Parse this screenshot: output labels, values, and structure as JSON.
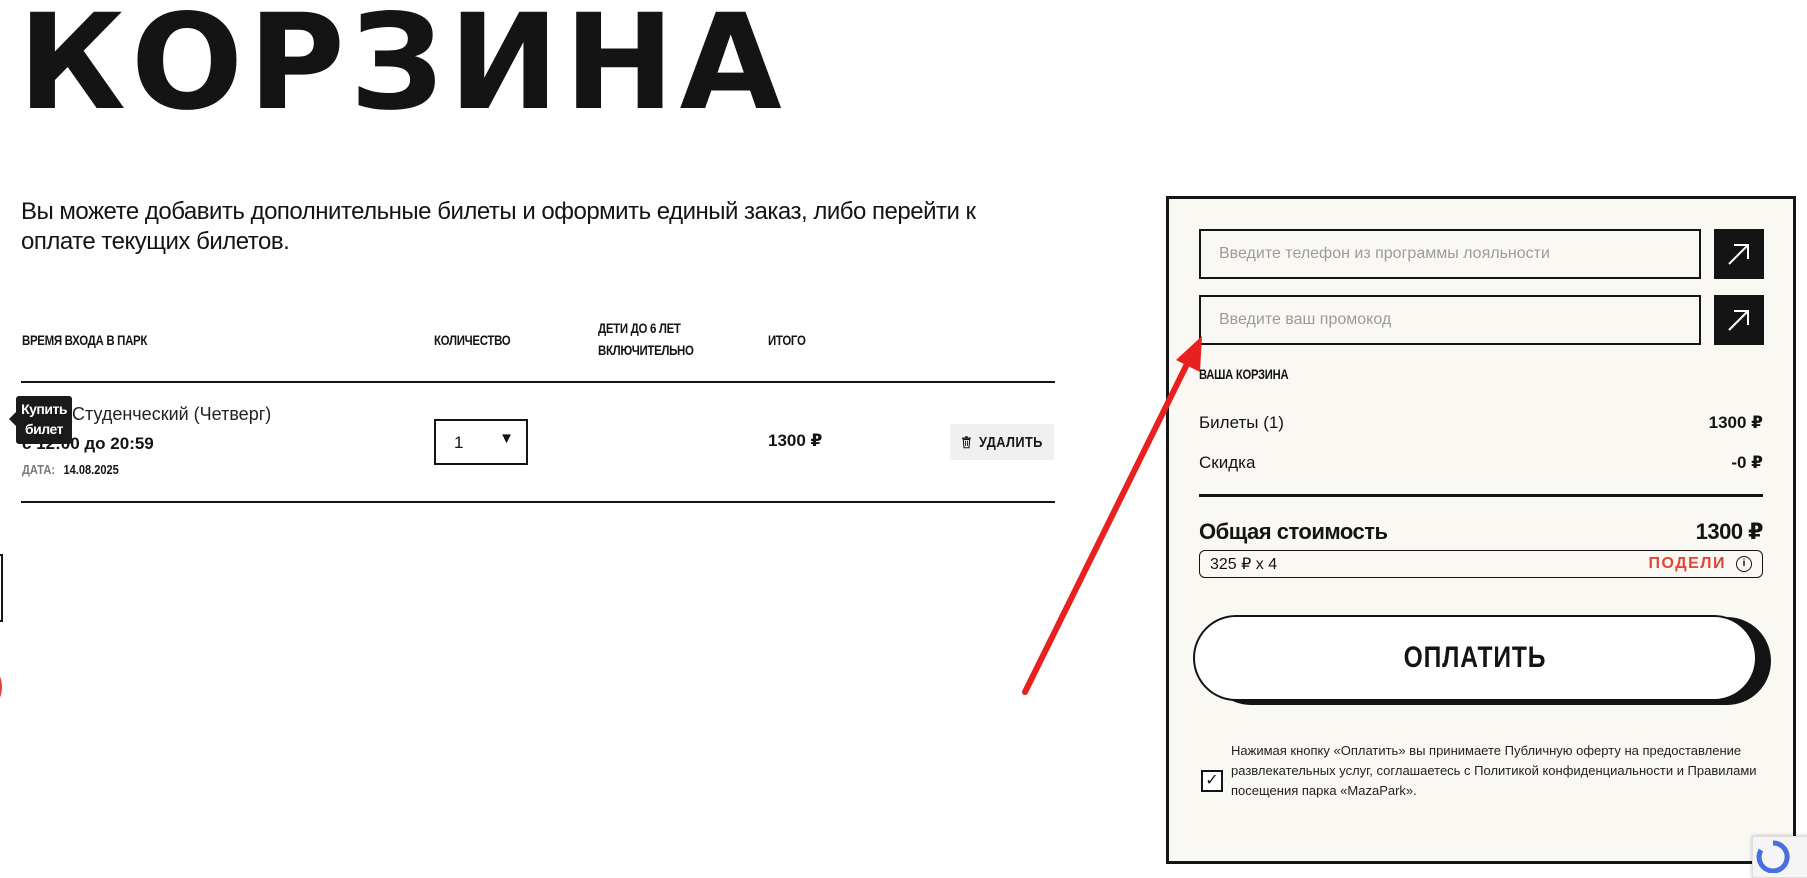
{
  "page": {
    "title": "КОРЗИНА",
    "intro": "Вы можете добавить дополнительные билеты и оформить единый заказ, либо перейти к оплате текущих билетов."
  },
  "table": {
    "headers": {
      "time": "ВРЕМЯ ВХОДА В ПАРК",
      "quantity": "КОЛИЧЕСТВО",
      "children_l1": "ДЕТИ ДО 6 ЛЕТ",
      "children_l2": "ВКЛЮЧИТЕЛЬНО",
      "total": "ИТОГО"
    },
    "row": {
      "name": "Студенческий (Четверг)",
      "time": "с 12:00 до 20:59",
      "date_label": "ДАТА:",
      "date": "14.08.2025",
      "quantity": "1",
      "total": "1300 ₽",
      "delete_label": "УДАЛИТЬ"
    },
    "tooltip_l1": "Купить",
    "tooltip_l2": "билет"
  },
  "cart": {
    "loyalty_placeholder": "Введите телефон из программы лояльности",
    "promo_placeholder": "Введите ваш промокод",
    "heading": "ВАША КОРЗИНА",
    "tickets_label": "Билеты (1)",
    "tickets_value": "1300 ₽",
    "discount_label": "Скидка",
    "discount_value": "-0 ₽",
    "total_label": "Общая стоимость",
    "total_value": "1300 ₽",
    "split_text": "325 ₽ x 4",
    "split_brand": "ПОДЕЛИ",
    "pay_label": "ОПЛАТИТЬ",
    "agreement_checked": true,
    "agreement_text": "Нажимая кнопку «Оплатить» вы принимаете Публичную оферту на предоставление развлекательных услуг, соглашаетесь с Политикой конфиденциальности и Правилами посещения парка «MazaPark»."
  },
  "colors": {
    "accent_red": "#e0453a",
    "panel_bg": "#faf8f3",
    "ink": "#141414"
  }
}
